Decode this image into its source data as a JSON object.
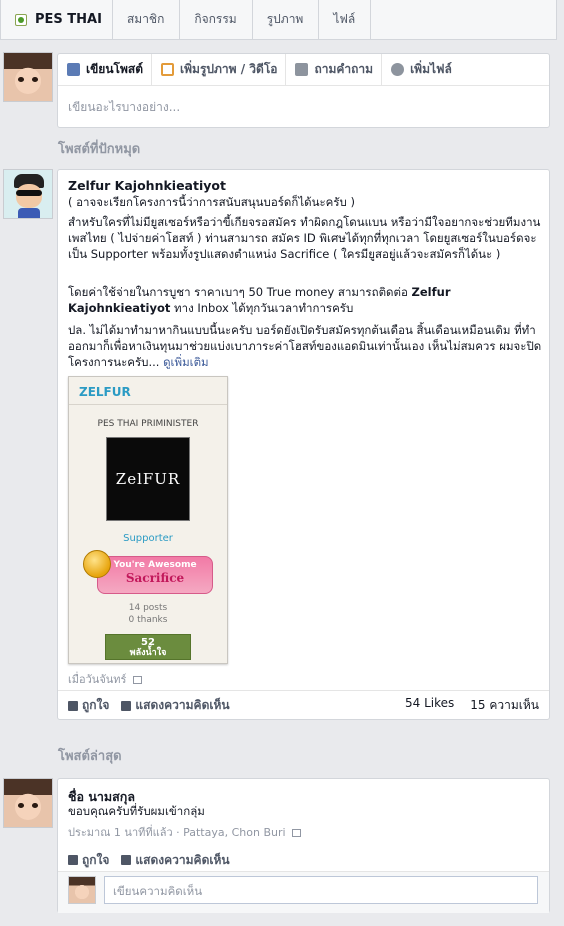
{
  "nav": {
    "brand": "PES THAI",
    "tabs": [
      "สมาชิก",
      "กิจกรรม",
      "รูปภาพ",
      "ไฟล์"
    ]
  },
  "composer": {
    "tabs": [
      {
        "label": "เขียนโพสต์",
        "icon": "pencil-icon"
      },
      {
        "label": "เพิ่มรูปภาพ / วิดีโอ",
        "icon": "photo-icon"
      },
      {
        "label": "ถามคำถาม",
        "icon": "question-icon"
      },
      {
        "label": "เพิ่มไฟล์",
        "icon": "file-icon"
      }
    ],
    "placeholder": "เขียนอะไรบางอย่าง..."
  },
  "pinned": {
    "section_title": "โพสต์ที่ปักหมุด",
    "author": "Zelfur Kajohnkieatiyot",
    "subtitle": "( อาจจะเรียกโครงการนี้ว่าการสนับสนุนบอร์ดก็ได้นะครับ )",
    "para1": "สำหรับใครที่ไม่มียูสเซอร์หรือว่าขี้เกียจรอสมัคร ทำผิดกฎโดนแบน หรือว่ามีใจอยากจะช่วยทีมงานเพสไทย ( ไปจ่ายค่าโฮสท์ ) ท่านสามารถ สมัคร ID พิเศษได้ทุกที่ทุกเวลา โดยยูสเซอร์ในบอร์ดจะเป็น Supporter พร้อมทั้งรูปแสดงตำแหน่ง Sacrifice ( ใครมียูสอยู่แล้วจะสมัครก็ได้นะ )",
    "para2_a": "โดยค่าใช้จ่ายในการบูชา ราคาเบาๆ 50 True money สามารถติดต่อ ",
    "para2_b": "Zelfur Kajohnkieatiyot",
    "para2_c": " ทาง Inbox ได้ทุกวันเวลาทำการครับ",
    "para3": "ปล. ไม่ได้มาทำมาหากินแบบนี้นะครับ บอร์ดยังเปิดรับสมัครทุกต้นเดือน สิ้นเดือนเหมือนเดิม ที่ทำออกมาก็เพื่อหาเงินทุนมาช่วยแบ่งเบาภาระค่าโฮสท์ของแอดมินเท่านั้นเอง เห็นไม่สมควร ผมจะปิดโครงการนะครับ...",
    "see_more": "ดูเพิ่มเติม",
    "card": {
      "header": "ZELFUR",
      "rank": "PES THAI PRIMINISTER",
      "logo_text": "ZelFUR",
      "role": "Supporter",
      "badge_line1": "You're Awesome",
      "badge_line2": "Sacrifice",
      "posts": "14 posts",
      "thanks": "0 thanks",
      "bar_value": "52",
      "bar_label": "พลังน้ำใจ"
    },
    "timestamp": "เมื่อวันจันทร์",
    "like": "ถูกใจ",
    "comment": "แสดงความคิดเห็น",
    "likes_count": "54 Likes",
    "comments_count": "15 ความเห็น"
  },
  "recent": {
    "section_title": "โพสต์ล่าสุด",
    "author": "ชื่อ นามสกุล",
    "text": "ขอบคุณครับที่รับผมเข้ากลุ่ม",
    "meta": "ประมาณ 1 นาทีที่แล้ว · Pattaya, Chon Buri",
    "like": "ถูกใจ",
    "comment": "แสดงความคิดเห็น",
    "comment_placeholder": "เขียนความคิดเห็น"
  },
  "colors": {
    "background": "#e9eaed",
    "link": "#3b5998",
    "card_header": "#2b9bc4"
  }
}
